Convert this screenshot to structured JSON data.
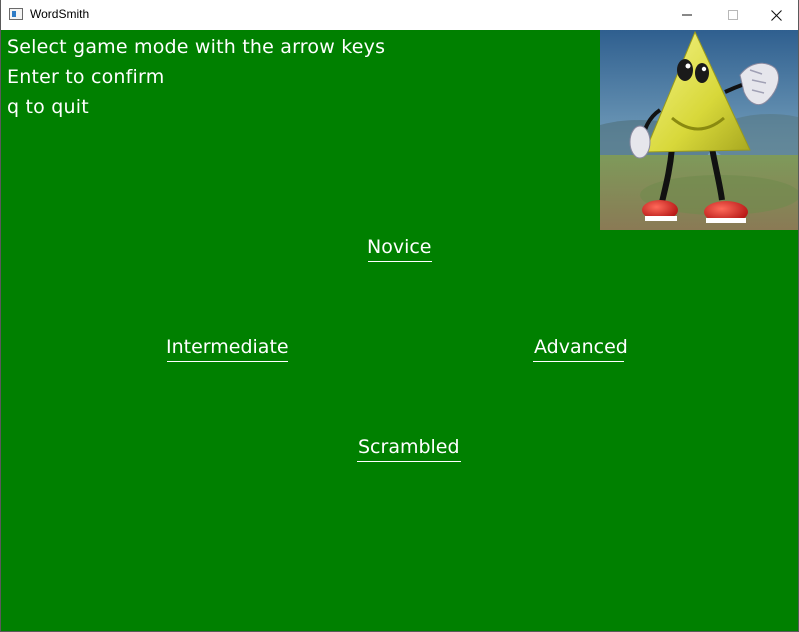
{
  "window": {
    "title": "WordSmith"
  },
  "instructions": {
    "line1": "Select game mode with the arrow keys",
    "line2": "Enter to confirm",
    "line3": "q to quit"
  },
  "modes": {
    "novice": "Novice",
    "intermediate": "Intermediate",
    "advanced": "Advanced",
    "scrambled": "Scrambled"
  },
  "colors": {
    "background": "#008000",
    "text": "#ffffff"
  },
  "icons": {
    "app": "app-window-icon",
    "minimize": "minimize-icon",
    "maximize": "maximize-icon",
    "close": "close-icon",
    "mascot": "mascot-image"
  }
}
